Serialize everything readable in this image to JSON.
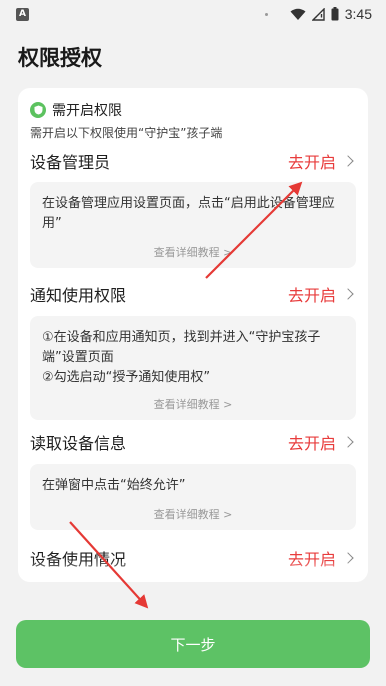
{
  "status_bar": {
    "left_icon_letter": "A",
    "time": "3:45",
    "icons": [
      "wifi-icon",
      "signal-icon",
      "battery-icon"
    ]
  },
  "page_title": "权限授权",
  "notice": {
    "title": "需开启权限",
    "subtitle": "需开启以下权限使用“守护宝”孩子端",
    "icon": "shield-icon"
  },
  "permissions": [
    {
      "name": "设备管理员",
      "action": "去开启",
      "description": "在设备管理应用设置页面，点击“启用此设备管理应用”",
      "link": "查看详细教程 >"
    },
    {
      "name": "通知使用权限",
      "action": "去开启",
      "description": "①在设备和应用通知页，找到并进入“守护宝孩子端”设置页面\n②勾选启动“授予通知使用权”",
      "link": "查看详细教程 >"
    },
    {
      "name": "读取设备信息",
      "action": "去开启",
      "description": "在弹窗中点击“始终允许”",
      "link": "查看详细教程 >"
    },
    {
      "name": "设备使用情况",
      "action": "去开启"
    }
  ],
  "next_button": "下一步",
  "colors": {
    "accent_green": "#5dc265",
    "action_red": "#e83c3c",
    "background": "#f2f2f2",
    "annotation_arrow": "#e53935"
  }
}
